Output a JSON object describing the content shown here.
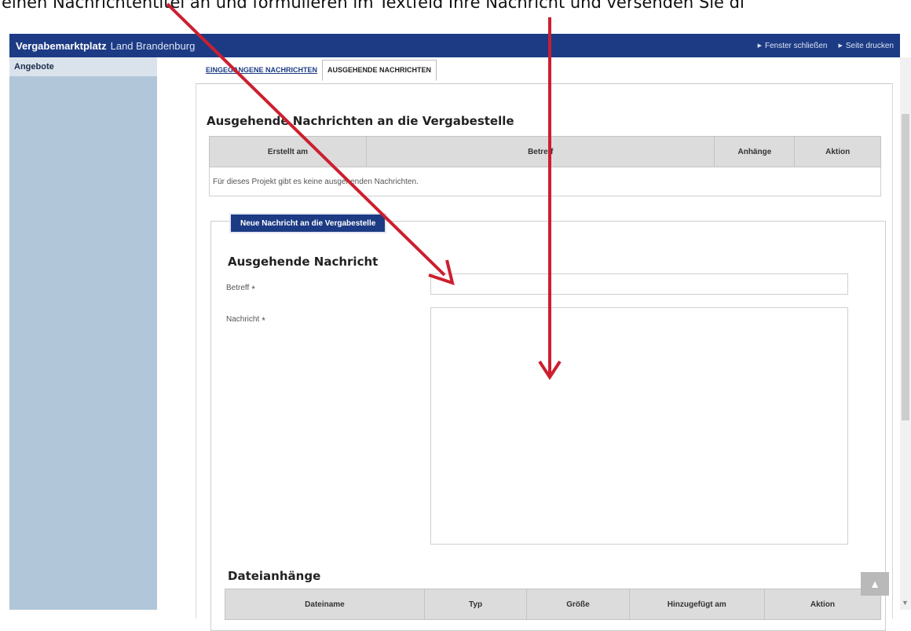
{
  "caption": {
    "text": "einen Nachrichtentitel an und formulieren im Textfeld Ihre Nachricht und versenden Sie di"
  },
  "header": {
    "brand_bold": "Vergabemarktplatz",
    "brand_light": "Land Brandenburg",
    "links": [
      "Fenster schließen",
      "Seite drucken"
    ]
  },
  "sidebar": {
    "title": "Angebote"
  },
  "tabs": [
    {
      "label": "EINGEGANGENE NACHRICHTEN",
      "active": false
    },
    {
      "label": "AUSGEHENDE NACHRICHTEN",
      "active": true
    }
  ],
  "outgoing": {
    "title": "Ausgehende Nachrichten an die Vergabestelle",
    "columns": [
      "Erstellt am",
      "Betreff",
      "Anhänge",
      "Aktion"
    ],
    "empty_text": "Für dieses Projekt gibt es keine ausgehenden Nachrichten."
  },
  "new_message": {
    "button_label": "Neue Nachricht an die Vergabestelle",
    "form_title": "Ausgehende Nachricht",
    "subject_label": "Betreff",
    "message_label": "Nachricht",
    "required_mark": "*"
  },
  "attachments": {
    "title": "Dateianhänge",
    "columns": [
      "Dateiname",
      "Typ",
      "Größe",
      "Hinzugefügt am",
      "Aktion"
    ]
  },
  "colors": {
    "header_bg": "#1c3b84",
    "sidebar_bg": "#b1c7d9",
    "annotation_arrow": "#cc1f2f"
  },
  "icons": {
    "link_marker": "triangle-right-icon",
    "back_to_top": "arrow-up-icon"
  }
}
